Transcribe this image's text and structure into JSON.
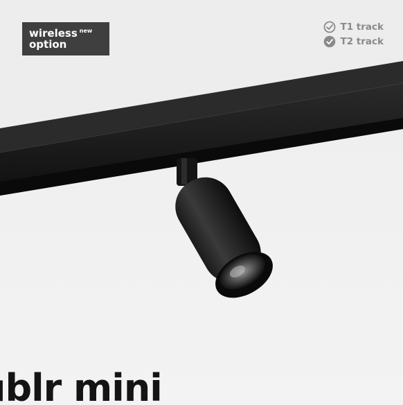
{
  "badge": {
    "word1": "wireless",
    "sup": "new",
    "word2": "option"
  },
  "tracks": [
    {
      "label": "T1 track",
      "icon": "check-circle-outline-icon"
    },
    {
      "label": "T2 track",
      "icon": "check-circle-filled-icon"
    }
  ],
  "product": {
    "name": "ublr mini",
    "image": "track-spotlight-image"
  },
  "colors": {
    "badge_bg": "#3f3f3f",
    "track_text": "#8a8a8a",
    "title": "#141414"
  }
}
